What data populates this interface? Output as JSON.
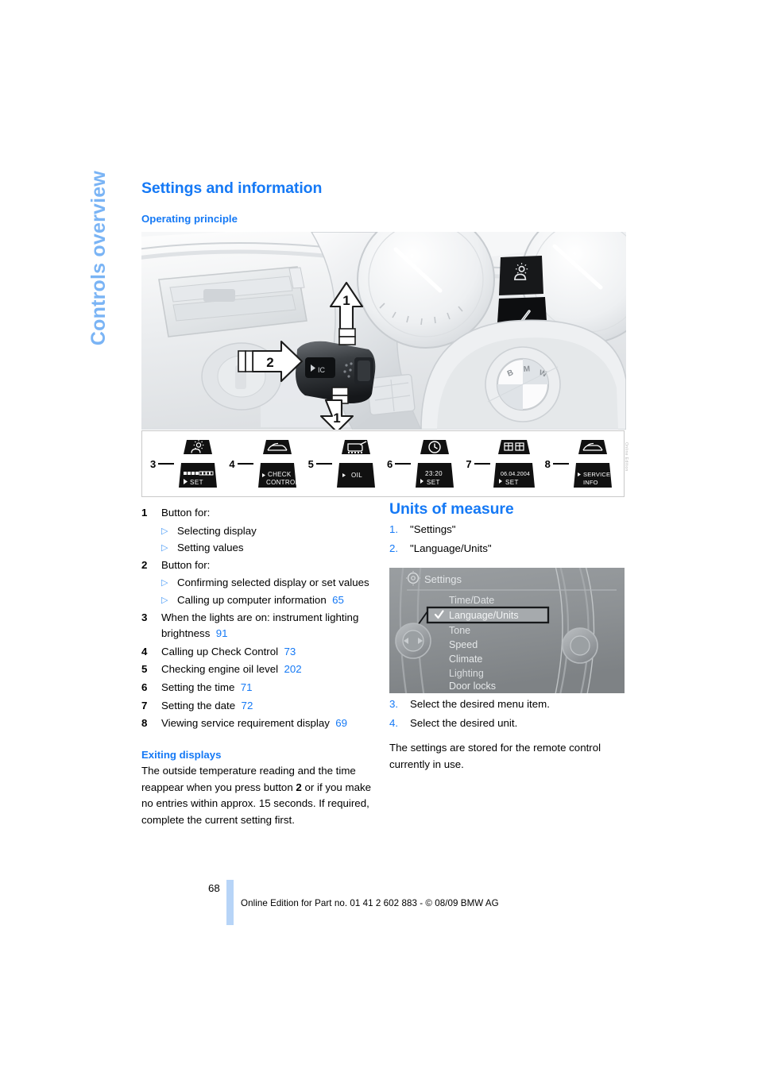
{
  "chapter_tab": {
    "label": "Controls overview"
  },
  "headings": {
    "page_title": "Settings and information",
    "operating_principle": "Operating principle",
    "exiting_displays": "Exiting displays",
    "units_of_measure": "Units of measure"
  },
  "colors": {
    "heading_blue": "#1579f5",
    "tab_blue": "#7ab4f5",
    "ref_blue": "#1579f5",
    "footer_bar_blue": "#b7d4f7"
  },
  "photo": {
    "callouts": [
      {
        "label": "1",
        "direction": "up"
      },
      {
        "label": "2",
        "direction": "right"
      },
      {
        "label": "1",
        "direction": "down"
      }
    ],
    "steering_wheel_logo": "BMW",
    "cluster_icon": "brightness-sun-icon"
  },
  "icon_strip": {
    "devices": [
      {
        "number": "3",
        "icon": "brightness-sun-icon",
        "line1": "",
        "line2": "SET",
        "bars": true,
        "arrow": true
      },
      {
        "number": "4",
        "icon": "car-icon",
        "line1": "CHECK",
        "line2": "CONTROL",
        "bars": false,
        "arrow": true
      },
      {
        "number": "5",
        "icon": "oil-can-icon",
        "line1": "OIL",
        "line2": "",
        "bars": false,
        "arrow": true
      },
      {
        "number": "6",
        "icon": "clock-icon",
        "line1": "23:20",
        "line2": "SET",
        "bars": false,
        "arrow": true
      },
      {
        "number": "7",
        "icon": "calendar-icon",
        "line1": "06.04.2004",
        "line2": "SET",
        "bars": false,
        "arrow": true
      },
      {
        "number": "8",
        "icon": "car-icon",
        "line1": "SERVICE -",
        "line2": "INFO",
        "bars": false,
        "arrow": true
      }
    ],
    "edge_code": "Online Edition"
  },
  "legend": [
    {
      "num": "1",
      "text": "Button for:",
      "subs": [
        {
          "text": "Selecting display",
          "ref": ""
        },
        {
          "text": "Setting values",
          "ref": ""
        }
      ]
    },
    {
      "num": "2",
      "text": "Button for:",
      "subs": [
        {
          "text": "Confirming selected display or set values",
          "ref": ""
        },
        {
          "text": "Calling up computer information",
          "ref": "65"
        }
      ]
    },
    {
      "num": "3",
      "text": "When the lights are on: instrument lighting brightness",
      "ref": "91",
      "subs": []
    },
    {
      "num": "4",
      "text": "Calling up Check Control",
      "ref": "73",
      "subs": []
    },
    {
      "num": "5",
      "text": "Checking engine oil level",
      "ref": "202",
      "subs": []
    },
    {
      "num": "6",
      "text": "Setting the time",
      "ref": "71",
      "subs": []
    },
    {
      "num": "7",
      "text": "Setting the date",
      "ref": "72",
      "subs": []
    },
    {
      "num": "8",
      "text": "Viewing service requirement display",
      "ref": "69",
      "subs": []
    }
  ],
  "exiting_displays": {
    "before_bold": "The outside temperature reading and the time reappear when you press button ",
    "bold": "2",
    "after_bold": " or if you make no entries within approx. 15 seconds. If required, complete the current setting first."
  },
  "units_of_measure": {
    "steps_before": [
      {
        "num": "1.",
        "text": "\"Settings\""
      },
      {
        "num": "2.",
        "text": "\"Language/Units\""
      }
    ],
    "steps_after": [
      {
        "num": "3.",
        "text": "Select the desired menu item."
      },
      {
        "num": "4.",
        "text": "Select the desired unit."
      }
    ],
    "note": "The settings are stored for the remote control currently in use."
  },
  "idrive_screen": {
    "header": "Settings",
    "header_icon": "gear-icon",
    "menu_items": [
      {
        "label": "Time/Date",
        "selected": false
      },
      {
        "label": "Language/Units",
        "selected": true
      },
      {
        "label": "Tone",
        "selected": false
      },
      {
        "label": "Speed",
        "selected": false
      },
      {
        "label": "Climate",
        "selected": false
      },
      {
        "label": "Lighting",
        "selected": false
      },
      {
        "label": "Door locks",
        "selected": false
      }
    ],
    "selected_marker": "✓"
  },
  "footer": {
    "page_number": "68",
    "text": "Online Edition for Part no. 01 41 2 602 883 - © 08/09 BMW AG"
  }
}
